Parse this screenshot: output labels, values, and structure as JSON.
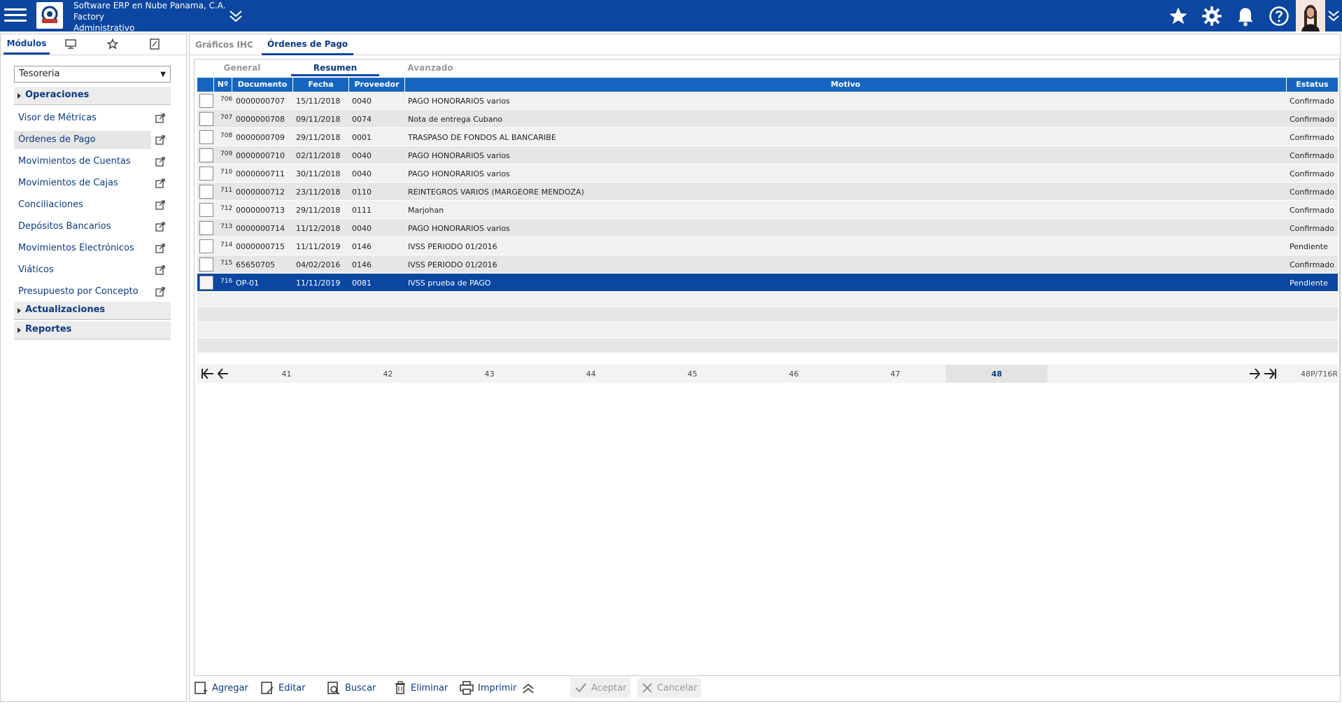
{
  "header": {
    "company_line1": "Software ERP en Nube Panama, C.A.",
    "company_line2": "Factory",
    "company_line3": "Administrativo"
  },
  "left": {
    "tabs": [
      "Módulos"
    ],
    "module_select": "Tesoreria",
    "groups": {
      "operaciones": "Operaciones",
      "actualizaciones": "Actualizaciones",
      "reportes": "Reportes"
    },
    "items": [
      "Visor de Métricas",
      "Órdenes de Pago",
      "Movimientos de Cuentas",
      "Movimientos de Cajas",
      "Conciliaciones",
      "Depósitos Bancarios",
      "Movimientos Electrónicos",
      "Viáticos",
      "Presupuesto por Concepto"
    ]
  },
  "main": {
    "tabs": [
      "Gráficos IHC",
      "Órdenes de Pago"
    ],
    "subtabs": [
      "General",
      "Resumen",
      "Avanzado"
    ],
    "columns": [
      "Nº",
      "Documento",
      "Fecha",
      "Proveedor",
      "Motivo",
      "Estatus"
    ],
    "rows": [
      {
        "n": "706",
        "doc": "0000000707",
        "fecha": "15/11/2018",
        "prov": "0040",
        "motivo": "PAGO HONORARIOS varios",
        "estatus": "Confirmado"
      },
      {
        "n": "707",
        "doc": "0000000708",
        "fecha": "09/11/2018",
        "prov": "0074",
        "motivo": "Nota de entrega Cubano",
        "estatus": "Confirmado"
      },
      {
        "n": "708",
        "doc": "0000000709",
        "fecha": "29/11/2018",
        "prov": "0001",
        "motivo": "TRASPASO DE FONDOS AL BANCARIBE",
        "estatus": "Confirmado"
      },
      {
        "n": "709",
        "doc": "0000000710",
        "fecha": "02/11/2018",
        "prov": "0040",
        "motivo": "PAGO HONORARIOS varios",
        "estatus": "Confirmado"
      },
      {
        "n": "710",
        "doc": "0000000711",
        "fecha": "30/11/2018",
        "prov": "0040",
        "motivo": "PAGO HONORARIOS varios",
        "estatus": "Confirmado"
      },
      {
        "n": "711",
        "doc": "0000000712",
        "fecha": "23/11/2018",
        "prov": "0110",
        "motivo": "REINTEGROS VARIOS (MARGEORE MENDOZA)",
        "estatus": "Confirmado"
      },
      {
        "n": "712",
        "doc": "0000000713",
        "fecha": "29/11/2018",
        "prov": "0111",
        "motivo": "Marjohan",
        "estatus": "Confirmado"
      },
      {
        "n": "713",
        "doc": "0000000714",
        "fecha": "11/12/2018",
        "prov": "0040",
        "motivo": "PAGO HONORARIOS varios",
        "estatus": "Confirmado"
      },
      {
        "n": "714",
        "doc": "0000000715",
        "fecha": "11/11/2019",
        "prov": "0146",
        "motivo": "IVSS PERIODO 01/2016",
        "estatus": "Pendiente"
      },
      {
        "n": "715",
        "doc": "65650705",
        "fecha": "04/02/2016",
        "prov": "0146",
        "motivo": "IVSS PERIODO 01/2016",
        "estatus": "Confirmado"
      },
      {
        "n": "716",
        "doc": "OP-01",
        "fecha": "11/11/2019",
        "prov": "0081",
        "motivo": "IVSS prueba de PAGO",
        "estatus": "Pendiente"
      }
    ],
    "pager": {
      "pages": [
        "41",
        "42",
        "43",
        "44",
        "45",
        "46",
        "47",
        "48"
      ],
      "active": "48",
      "info": "48P/716R"
    },
    "actions": {
      "agregar": "Agregar",
      "editar": "Editar",
      "buscar": "Buscar",
      "eliminar": "Eliminar",
      "imprimir": "Imprimir",
      "aceptar": "Aceptar",
      "cancelar": "Cancelar"
    }
  },
  "colors": {
    "topbar": "#0b46a0",
    "grid_header": "#1565c0",
    "selected_row": "#0b46a0"
  }
}
